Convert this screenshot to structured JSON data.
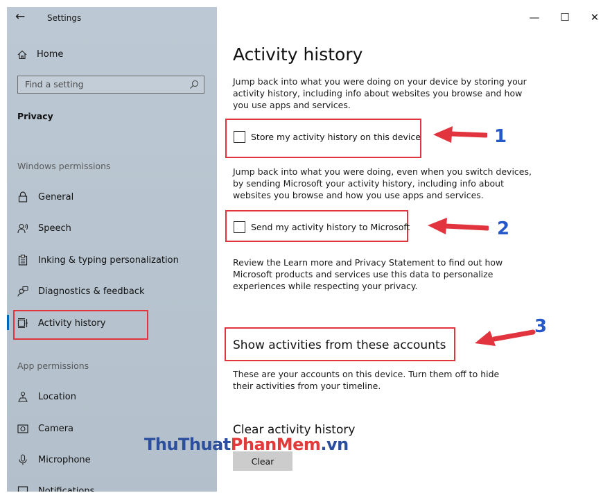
{
  "window": {
    "title": "Settings",
    "back_glyph": "←",
    "minimize_glyph": "—",
    "maximize_glyph": "☐",
    "close_glyph": "✕"
  },
  "sidebar": {
    "home_label": "Home",
    "search_placeholder": "Find a setting",
    "section_title": "Privacy",
    "windows_permissions_label": "Windows permissions",
    "app_permissions_label": "App permissions",
    "items": [
      {
        "label": "General",
        "icon": "lock-icon"
      },
      {
        "label": "Speech",
        "icon": "speech-icon"
      },
      {
        "label": "Inking & typing personalization",
        "icon": "clipboard-icon"
      },
      {
        "label": "Diagnostics & feedback",
        "icon": "feedback-icon"
      },
      {
        "label": "Activity history",
        "icon": "activity-icon",
        "active": true
      },
      {
        "label": "Location",
        "icon": "location-icon"
      },
      {
        "label": "Camera",
        "icon": "camera-icon"
      },
      {
        "label": "Microphone",
        "icon": "microphone-icon"
      },
      {
        "label": "Notifications",
        "icon": "notifications-icon"
      }
    ]
  },
  "main": {
    "page_title": "Activity history",
    "intro": "Jump back into what you were doing on your device by storing your activity history, including info about websites you browse and how you use apps and services.",
    "checkbox_store_label": "Store my activity history on this device",
    "checkbox_store_checked": false,
    "paragraph_2": "Jump back into what you were doing, even when you switch devices, by sending Microsoft your activity history, including info about websites you browse and how you use apps and services.",
    "checkbox_send_label": "Send my activity history to Microsoft",
    "checkbox_send_checked": false,
    "paragraph_3": "Review the Learn more and Privacy Statement to find out how Microsoft products and services use this data to personalize experiences while respecting your privacy.",
    "accounts_heading": "Show activities from these accounts",
    "accounts_text": "These are your accounts on this device. Turn them off to hide their activities from your timeline.",
    "clear_heading": "Clear activity history",
    "clear_button": "Clear"
  },
  "annotations": {
    "label_1": "1",
    "label_2": "2",
    "label_3": "3",
    "highlight_color": "#e2343e",
    "number_color": "#2658c9"
  },
  "watermark": {
    "part_a": "ThuThuat",
    "part_b": "PhanMem",
    "part_c": ".vn"
  },
  "colors": {
    "sidebar_bg": "#b8c5d0",
    "accent": "#0067b8",
    "button_bg": "#cccccc"
  }
}
